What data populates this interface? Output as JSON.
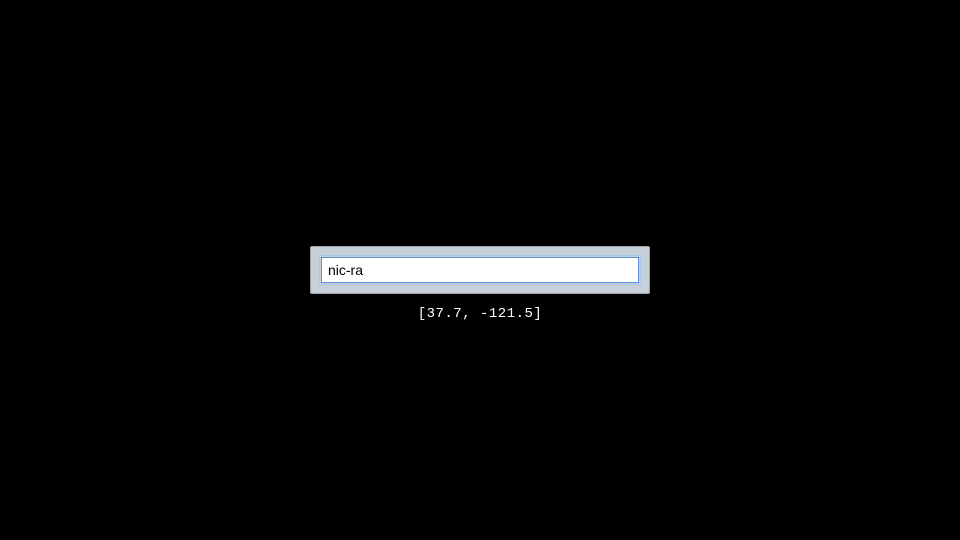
{
  "search": {
    "value": "nic-ra",
    "placeholder": ""
  },
  "coordinates": {
    "display": "[37.7, -121.5]"
  }
}
